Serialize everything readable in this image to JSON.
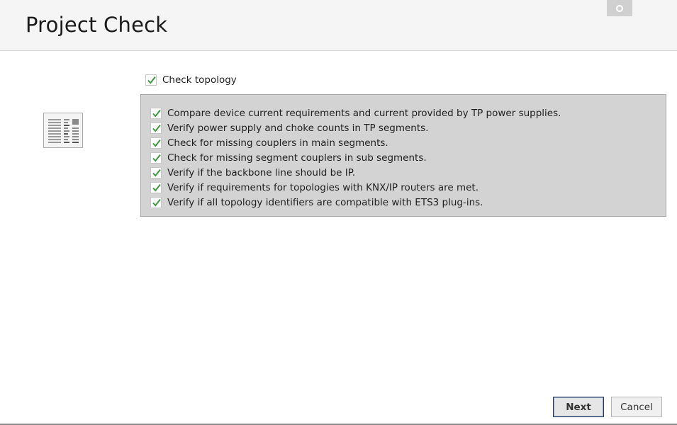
{
  "window": {
    "title": "Project Check"
  },
  "topology": {
    "master_label": "Check topology",
    "master_checked": true,
    "checks": [
      {
        "label": "Compare device current requirements and current provided by TP power supplies.",
        "checked": true
      },
      {
        "label": "Verify power supply and choke counts in TP segments.",
        "checked": true
      },
      {
        "label": "Check for missing couplers in main segments.",
        "checked": true
      },
      {
        "label": "Check for missing segment couplers in sub segments.",
        "checked": true
      },
      {
        "label": "Verify if the backbone line should be IP.",
        "checked": true
      },
      {
        "label": "Verify if requirements for topologies with KNX/IP routers are met.",
        "checked": true
      },
      {
        "label": "Verify if all topology identifiers are compatible with ETS3 plug-ins.",
        "checked": true
      }
    ]
  },
  "footer": {
    "next_label": "Next",
    "cancel_label": "Cancel"
  },
  "icons": {
    "check": "checkmark-icon",
    "side": "report-document-icon",
    "top": "settings-circle-icon"
  },
  "colors": {
    "check_green": "#3c9a3c",
    "panel_bg": "#d3d3d3",
    "header_bg": "#f5f5f5"
  }
}
